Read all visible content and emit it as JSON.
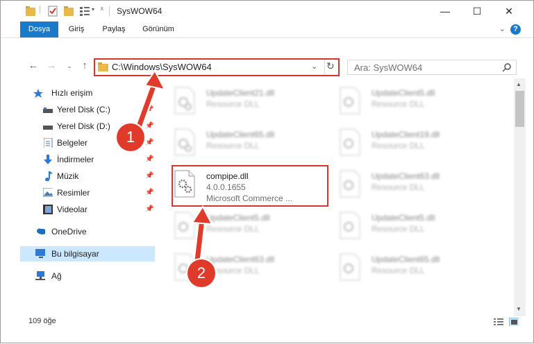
{
  "window": {
    "title": "SysWOW64"
  },
  "controls": {
    "minimize": "—",
    "maximize": "☐",
    "close": "✕"
  },
  "ribbon": {
    "tabs": [
      "Dosya",
      "Giriş",
      "Paylaş",
      "Görünüm"
    ],
    "active": "Dosya",
    "help": "?"
  },
  "address": {
    "path": "C:\\Windows\\SysWOW64"
  },
  "search": {
    "placeholder": "Ara: SysWOW64"
  },
  "sidebar": {
    "items": [
      {
        "label": "Hızlı erişim",
        "icon": "star-icon"
      },
      {
        "label": "Yerel Disk (C:)",
        "icon": "drive-icon",
        "pinned": true
      },
      {
        "label": "Yerel Disk (D:)",
        "icon": "drive-icon",
        "pinned": true
      },
      {
        "label": "Belgeler",
        "icon": "documents-icon",
        "pinned": true
      },
      {
        "label": "İndirmeler",
        "icon": "download-icon",
        "pinned": true
      },
      {
        "label": "Müzik",
        "icon": "music-icon",
        "pinned": true
      },
      {
        "label": "Resimler",
        "icon": "pictures-icon",
        "pinned": true
      },
      {
        "label": "Videolar",
        "icon": "video-icon",
        "pinned": true
      },
      {
        "label": "OneDrive",
        "icon": "cloud-icon"
      },
      {
        "label": "Bu bilgisayar",
        "icon": "computer-icon",
        "selected": true
      },
      {
        "label": "Ağ",
        "icon": "network-icon"
      }
    ]
  },
  "files": {
    "left": [
      {
        "name": "UpdateClient21.dll",
        "type": "Resource DLL"
      },
      {
        "name": "UpdateClient65.dll",
        "type": "Resource DLL"
      },
      {
        "name": "compipe.dll",
        "version": "4.0.0.1655",
        "company": "Microsoft Commerce ..."
      },
      {
        "name": "UpdateClient5.dll",
        "type": "Resource DLL"
      },
      {
        "name": "UpdateClient63.dll",
        "type": "Resource DLL"
      }
    ],
    "right": [
      {
        "name": "UpdateClient5.dll",
        "type": "Resource DLL"
      },
      {
        "name": "UpdateClient19.dll",
        "type": "Resource DLL"
      },
      {
        "name": "UpdateClient63.dll",
        "type": "Resource DLL"
      },
      {
        "name": "UpdateClient5.dll",
        "type": "Resource DLL"
      },
      {
        "name": "UpdateClient65.dll",
        "type": "Resource DLL"
      }
    ]
  },
  "status": {
    "count": "109 öğe"
  },
  "annotations": {
    "badge1": "1",
    "badge2": "2"
  },
  "colors": {
    "accent": "#1979ca",
    "highlight": "#d9342b",
    "selected": "#cce8ff"
  }
}
